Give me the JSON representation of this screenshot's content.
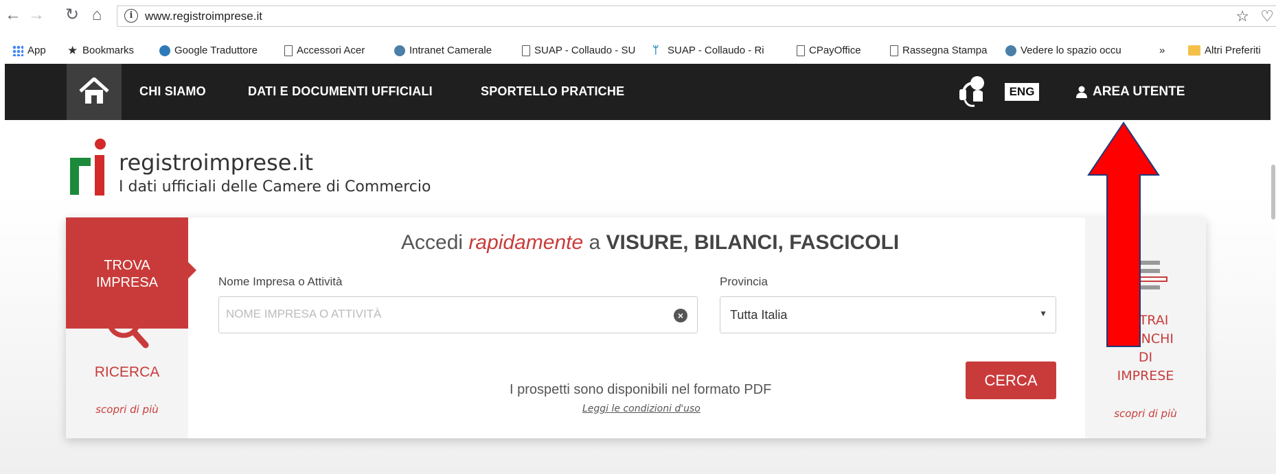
{
  "browser": {
    "url": "www.registroimprese.it",
    "bookmarks": [
      {
        "label": "App",
        "icon": "apps-icon"
      },
      {
        "label": "Bookmarks",
        "icon": "star-icon"
      },
      {
        "label": "Google Traduttore",
        "icon": "translate-icon"
      },
      {
        "label": "Accessori Acer",
        "icon": "page-icon"
      },
      {
        "label": "Intranet Camerale",
        "icon": "globe-icon"
      },
      {
        "label": "SUAP - Collaudo - SU",
        "icon": "page-icon"
      },
      {
        "label": "SUAP - Collaudo - Ri",
        "icon": "bird-icon"
      },
      {
        "label": "CPayOffice",
        "icon": "page-icon"
      },
      {
        "label": "Rassegna Stampa",
        "icon": "page-icon"
      },
      {
        "label": "Vedere lo spazio occu",
        "icon": "globe-icon"
      },
      {
        "label": "»",
        "icon": ""
      },
      {
        "label": "Altri Preferiti",
        "icon": "folder-icon"
      }
    ]
  },
  "nav": {
    "chi_siamo": "CHI SIAMO",
    "dati": "DATI E DOCUMENTI UFFICIALI",
    "sportello": "SPORTELLO PRATICHE",
    "eng": "ENG",
    "area_utente": "AREA UTENTE"
  },
  "logo": {
    "name": "registroimprese.it",
    "tagline": "I dati ufficiali delle Camere di Commercio"
  },
  "search": {
    "left_title_1": "TROVA",
    "left_title_2": "IMPRESA",
    "ricerca": "RICERCA",
    "scopri": "scopri di più",
    "title_pre": "Accedi ",
    "title_em": "rapidamente",
    "title_mid": " a ",
    "title_bold": "VISURE, BILANCI, FASCICOLI",
    "name_label": "Nome Impresa o Attività",
    "name_placeholder": "NOME IMPRESA O ATTIVITÀ",
    "provincia_label": "Provincia",
    "provincia_value": "Tutta Italia",
    "cerca": "CERCA",
    "prospetti": "I prospetti sono disponibili nel formato PDF",
    "leggi": "Leggi le condizioni d'uso"
  },
  "right_panel": {
    "line1": "ESTRAI",
    "line2": "ELENCHI",
    "line3": "DI",
    "line4": "IMPRESE",
    "scopri": "scopri di più"
  },
  "colors": {
    "brand_red": "#c93b3b",
    "nav_bg": "#1f1f1f",
    "annotation_arrow": "#ff0000"
  }
}
